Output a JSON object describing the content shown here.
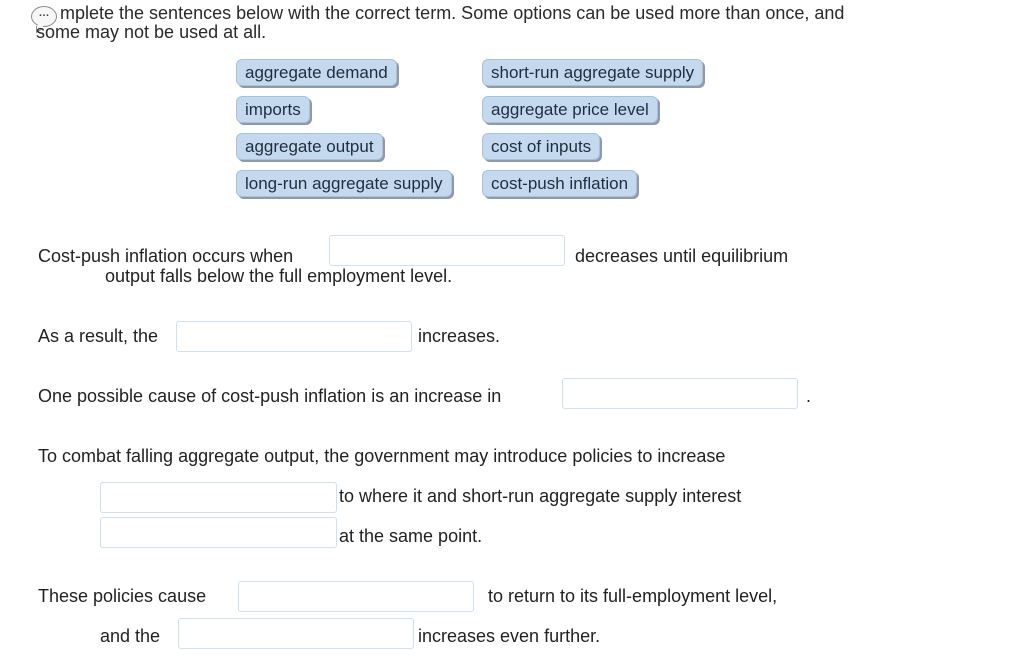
{
  "instructions": {
    "line1": "mplete the sentences below with the correct term. Some options can be used more than once, and",
    "line2": "some may not be used at all.",
    "hint_glyph": "…"
  },
  "options": [
    "aggregate demand",
    "short-run aggregate supply",
    "imports",
    "aggregate price level",
    "aggregate output",
    "cost of inputs",
    "long-run aggregate supply",
    "cost-push inflation"
  ],
  "sentences": {
    "s1_a": "Cost-push inflation occurs when",
    "s1_b": "decreases until equilibrium",
    "s1_c": "output falls below the full employment level.",
    "s2_a": "As a result, the",
    "s2_b": "increases.",
    "s3_a": "One possible cause of cost-push inflation is an increase in",
    "s3_b": ".",
    "s4_a": "To combat falling aggregate output, the government may introduce policies to increase",
    "s4_b": "to where it and short-run aggregate supply interest",
    "s4_c": "at the same point.",
    "s5_a": "These policies cause",
    "s5_b": "to return to its full-employment level,",
    "s5_c": "and the",
    "s5_d": "increases even further."
  },
  "blanks": [
    "",
    "",
    "",
    "",
    "",
    "",
    ""
  ]
}
